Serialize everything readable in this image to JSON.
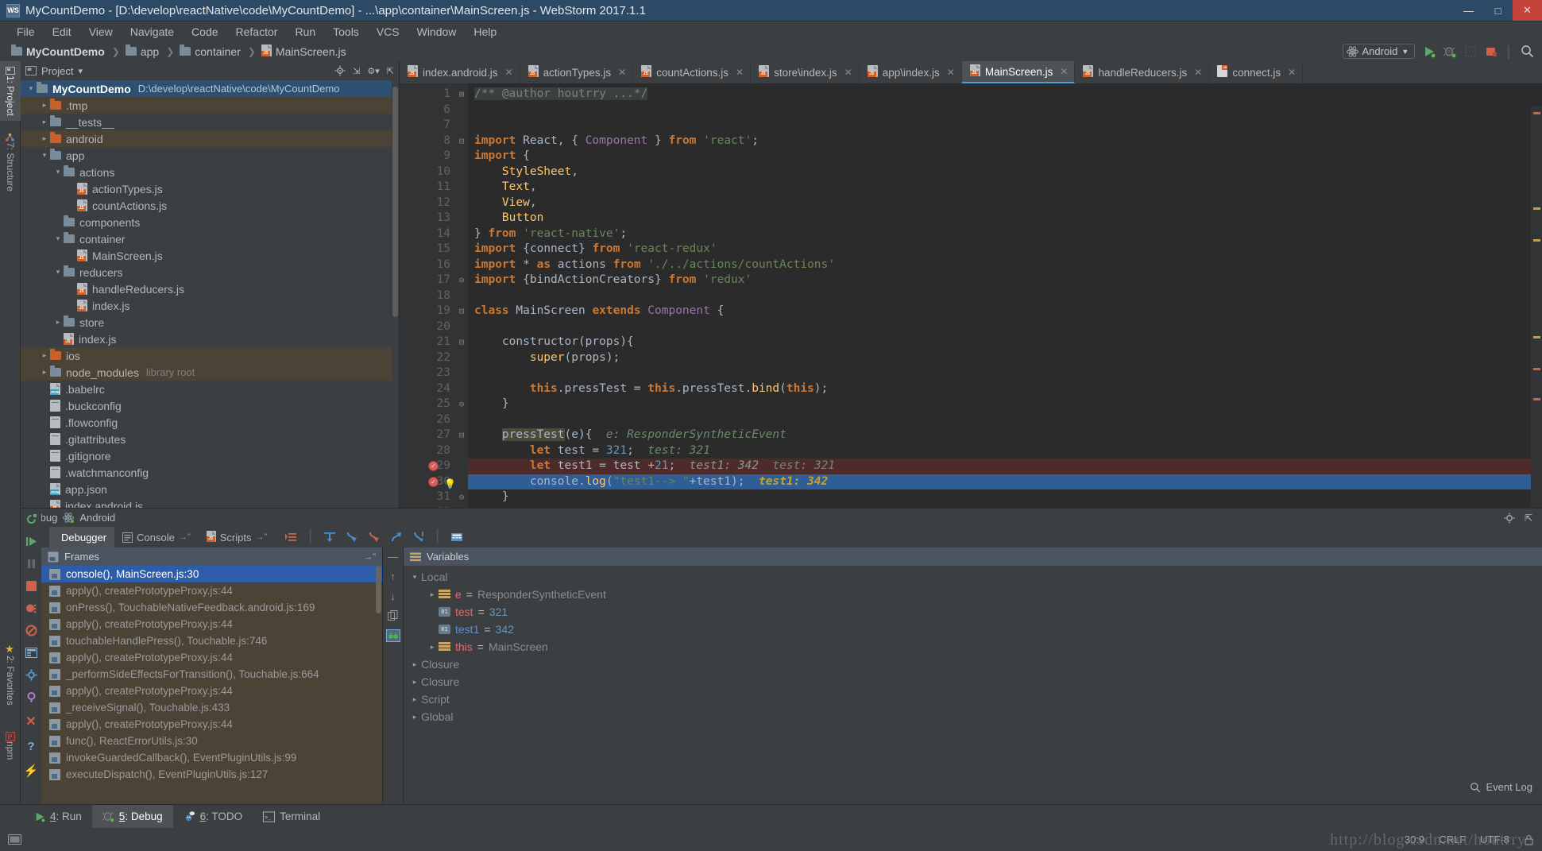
{
  "window": {
    "title": "MyCountDemo - [D:\\develop\\reactNative\\code\\MyCountDemo] - ...\\app\\container\\MainScreen.js - WebStorm 2017.1.1",
    "logo": "WS",
    "minimize": "—",
    "maximize": "□",
    "close": "✕"
  },
  "menubar": [
    {
      "label": "File"
    },
    {
      "label": "Edit"
    },
    {
      "label": "View"
    },
    {
      "label": "Navigate"
    },
    {
      "label": "Code"
    },
    {
      "label": "Refactor"
    },
    {
      "label": "Run"
    },
    {
      "label": "Tools"
    },
    {
      "label": "VCS"
    },
    {
      "label": "Window"
    },
    {
      "label": "Help"
    }
  ],
  "breadcrumb": [
    {
      "label": "MyCountDemo",
      "icon": "folder-icon"
    },
    {
      "label": "app",
      "icon": "folder-icon"
    },
    {
      "label": "container",
      "icon": "folder-icon"
    },
    {
      "label": "MainScreen.js",
      "icon": "js-file-icon"
    }
  ],
  "toolbar": {
    "run_config": "Android",
    "run_button": "run-icon",
    "debug_button": "debug-icon",
    "coverage_button": "coverage-icon",
    "stop_button": "stop-icon",
    "search_button": "search-icon"
  },
  "left_rail": [
    {
      "label": "1: Project",
      "active": true
    },
    {
      "label": "7: Structure",
      "active": false
    },
    {
      "label": "2: Favorites",
      "active": false
    },
    {
      "label": "npm",
      "active": false
    }
  ],
  "project_panel": {
    "title": "Project",
    "chevron": "▾",
    "actions": [
      "gear-icon",
      "collapse-icon",
      "settings-icon",
      "hide-icon"
    ],
    "tree": [
      {
        "depth": 0,
        "arrow": "▾",
        "icon": "folder-icon",
        "label": "MyCountDemo",
        "bold": true,
        "note": "D:\\develop\\reactNative\\code\\MyCountDemo",
        "state": "selected"
      },
      {
        "depth": 1,
        "arrow": "▸",
        "icon": "folder-orange-icon",
        "label": ".tmp",
        "note": "",
        "state": "highlight"
      },
      {
        "depth": 1,
        "arrow": "▸",
        "icon": "folder-icon",
        "label": "__tests__",
        "note": "",
        "state": ""
      },
      {
        "depth": 1,
        "arrow": "▸",
        "icon": "folder-orange-icon",
        "label": "android",
        "note": "",
        "state": "highlight"
      },
      {
        "depth": 1,
        "arrow": "▾",
        "icon": "folder-icon",
        "label": "app",
        "note": "",
        "state": ""
      },
      {
        "depth": 2,
        "arrow": "▾",
        "icon": "folder-icon",
        "label": "actions",
        "note": "",
        "state": ""
      },
      {
        "depth": 3,
        "arrow": "",
        "icon": "js-file-icon",
        "label": "actionTypes.js",
        "note": "",
        "state": ""
      },
      {
        "depth": 3,
        "arrow": "",
        "icon": "js-file-icon",
        "label": "countActions.js",
        "note": "",
        "state": ""
      },
      {
        "depth": 2,
        "arrow": "",
        "icon": "folder-icon",
        "label": "components",
        "note": "",
        "state": ""
      },
      {
        "depth": 2,
        "arrow": "▾",
        "icon": "folder-icon",
        "label": "container",
        "note": "",
        "state": ""
      },
      {
        "depth": 3,
        "arrow": "",
        "icon": "js-file-icon",
        "label": "MainScreen.js",
        "note": "",
        "state": ""
      },
      {
        "depth": 2,
        "arrow": "▾",
        "icon": "folder-icon",
        "label": "reducers",
        "note": "",
        "state": ""
      },
      {
        "depth": 3,
        "arrow": "",
        "icon": "js-file-icon",
        "label": "handleReducers.js",
        "note": "",
        "state": ""
      },
      {
        "depth": 3,
        "arrow": "",
        "icon": "js-file-icon",
        "label": "index.js",
        "note": "",
        "state": ""
      },
      {
        "depth": 2,
        "arrow": "▸",
        "icon": "folder-icon",
        "label": "store",
        "note": "",
        "state": ""
      },
      {
        "depth": 2,
        "arrow": "",
        "icon": "js-file-icon",
        "label": "index.js",
        "note": "",
        "state": ""
      },
      {
        "depth": 1,
        "arrow": "▸",
        "icon": "folder-orange-icon",
        "label": "ios",
        "note": "",
        "state": "highlight"
      },
      {
        "depth": 1,
        "arrow": "▸",
        "icon": "folder-icon",
        "label": "node_modules",
        "note": "library root",
        "state": "highlight"
      },
      {
        "depth": 1,
        "arrow": "",
        "icon": "json-file-icon",
        "label": ".babelrc",
        "note": "",
        "state": ""
      },
      {
        "depth": 1,
        "arrow": "",
        "icon": "text-file-icon",
        "label": ".buckconfig",
        "note": "",
        "state": ""
      },
      {
        "depth": 1,
        "arrow": "",
        "icon": "text-file-icon",
        "label": ".flowconfig",
        "note": "",
        "state": ""
      },
      {
        "depth": 1,
        "arrow": "",
        "icon": "text-file-icon",
        "label": ".gitattributes",
        "note": "",
        "state": ""
      },
      {
        "depth": 1,
        "arrow": "",
        "icon": "text-file-icon",
        "label": ".gitignore",
        "note": "",
        "state": ""
      },
      {
        "depth": 1,
        "arrow": "",
        "icon": "text-file-icon",
        "label": ".watchmanconfig",
        "note": "",
        "state": ""
      },
      {
        "depth": 1,
        "arrow": "",
        "icon": "json-file-icon",
        "label": "app.json",
        "note": "",
        "state": ""
      },
      {
        "depth": 1,
        "arrow": "",
        "icon": "js-file-icon",
        "label": "index.android.js",
        "note": "",
        "state": ""
      }
    ]
  },
  "editor_tabs": [
    {
      "label": "index.android.js",
      "icon": "js-file-icon",
      "active": false
    },
    {
      "label": "actionTypes.js",
      "icon": "js-file-icon",
      "active": false
    },
    {
      "label": "countActions.js",
      "icon": "js-file-icon",
      "active": false
    },
    {
      "label": "store\\index.js",
      "icon": "js-file-icon",
      "active": false
    },
    {
      "label": "app\\index.js",
      "icon": "js-file-icon",
      "active": false
    },
    {
      "label": "MainScreen.js",
      "icon": "js-file-icon",
      "active": true
    },
    {
      "label": "handleReducers.js",
      "icon": "js-file-icon",
      "active": false
    },
    {
      "label": "connect.js",
      "icon": "js-lib-file-icon",
      "active": false
    }
  ],
  "editor": {
    "close_glyph": "✕",
    "lines": [
      {
        "num": "1",
        "fold": "⊞",
        "state": "",
        "breakpoint": false,
        "bulb": false,
        "html": "<span class=\"doc-hl cm\">/** @author houtrry ...*/</span>"
      },
      {
        "num": "6",
        "fold": "",
        "state": "",
        "breakpoint": false,
        "bulb": false,
        "html": ""
      },
      {
        "num": "7",
        "fold": "",
        "state": "",
        "breakpoint": false,
        "bulb": false,
        "html": ""
      },
      {
        "num": "8",
        "fold": "⊟",
        "state": "",
        "breakpoint": false,
        "bulb": false,
        "html": "<span class=\"k\">import</span> <span class=\"pl\">React</span><span class=\"pl\">, { </span><span class=\"typ\">Component</span><span class=\"pl\"> } </span><span class=\"k\">from</span> <span class=\"s\">'react'</span><span class=\"pl\">;</span>"
      },
      {
        "num": "9",
        "fold": "",
        "state": "",
        "breakpoint": false,
        "bulb": false,
        "html": "<span class=\"k\">import</span> <span class=\"pl\">{</span>"
      },
      {
        "num": "10",
        "fold": "",
        "state": "",
        "breakpoint": false,
        "bulb": false,
        "html": "    <span class=\"fn\">StyleSheet</span><span class=\"pl\">,</span>"
      },
      {
        "num": "11",
        "fold": "",
        "state": "",
        "breakpoint": false,
        "bulb": false,
        "html": "    <span class=\"fn\">Text</span><span class=\"pl\">,</span>"
      },
      {
        "num": "12",
        "fold": "",
        "state": "",
        "breakpoint": false,
        "bulb": false,
        "html": "    <span class=\"fn\">View</span><span class=\"pl\">,</span>"
      },
      {
        "num": "13",
        "fold": "",
        "state": "",
        "breakpoint": false,
        "bulb": false,
        "html": "    <span class=\"fn\">Button</span>"
      },
      {
        "num": "14",
        "fold": "",
        "state": "",
        "breakpoint": false,
        "bulb": false,
        "html": "<span class=\"pl\">} </span><span class=\"k\">from</span> <span class=\"s\">'react-native'</span><span class=\"pl\">;</span>"
      },
      {
        "num": "15",
        "fold": "",
        "state": "",
        "breakpoint": false,
        "bulb": false,
        "html": "<span class=\"k\">import</span> <span class=\"pl\">{connect} </span><span class=\"k\">from</span> <span class=\"s\">'react-redux'</span>"
      },
      {
        "num": "16",
        "fold": "",
        "state": "",
        "breakpoint": false,
        "bulb": false,
        "html": "<span class=\"k\">import</span> <span class=\"pl\">* </span><span class=\"k\">as</span> <span class=\"pl\">actions </span><span class=\"k\">from</span> <span class=\"s\">'./../actions/countActions'</span>"
      },
      {
        "num": "17",
        "fold": "⊖",
        "state": "",
        "breakpoint": false,
        "bulb": false,
        "html": "<span class=\"k\">import</span> <span class=\"pl\">{bindActionCreators} </span><span class=\"k\">from</span> <span class=\"s\">'redux'</span>"
      },
      {
        "num": "18",
        "fold": "",
        "state": "",
        "breakpoint": false,
        "bulb": false,
        "html": ""
      },
      {
        "num": "19",
        "fold": "⊟",
        "state": "",
        "breakpoint": false,
        "bulb": false,
        "html": "<span class=\"k\">class</span> <span class=\"pl\">MainScreen</span> <span class=\"k\">extends</span> <span class=\"typ\">Component</span> <span class=\"pl\">{</span>"
      },
      {
        "num": "20",
        "fold": "",
        "state": "",
        "breakpoint": false,
        "bulb": false,
        "html": ""
      },
      {
        "num": "21",
        "fold": "⊟",
        "state": "",
        "breakpoint": false,
        "bulb": false,
        "html": "    <span class=\"pl\">constructor(props){</span>"
      },
      {
        "num": "22",
        "fold": "",
        "state": "",
        "breakpoint": false,
        "bulb": false,
        "html": "        <span class=\"fn\">super</span><span class=\"pl\">(props);</span>"
      },
      {
        "num": "23",
        "fold": "",
        "state": "",
        "breakpoint": false,
        "bulb": false,
        "html": ""
      },
      {
        "num": "24",
        "fold": "",
        "state": "",
        "breakpoint": false,
        "bulb": false,
        "html": "        <span class=\"k\">this</span><span class=\"pl\">.pressTest = </span><span class=\"k\">this</span><span class=\"pl\">.pressTest.</span><span class=\"fn\">bind</span><span class=\"pl\">(</span><span class=\"k\">this</span><span class=\"pl\">);</span>"
      },
      {
        "num": "25",
        "fold": "⊖",
        "state": "",
        "breakpoint": false,
        "bulb": false,
        "html": "    <span class=\"pl\">}</span>"
      },
      {
        "num": "26",
        "fold": "",
        "state": "",
        "breakpoint": false,
        "bulb": false,
        "html": ""
      },
      {
        "num": "27",
        "fold": "⊟",
        "state": "",
        "breakpoint": false,
        "bulb": false,
        "html": "    <span class=\"hl-ident\">pressTest</span><span class=\"pl\">(e){</span>  <span class=\"hint\">e: ResponderSyntheticEvent</span>"
      },
      {
        "num": "28",
        "fold": "",
        "state": "",
        "breakpoint": false,
        "bulb": false,
        "html": "        <span class=\"k\">let</span> <span class=\"pl\">test = </span><span class=\"num\">321</span><span class=\"pl\">;</span>  <span class=\"hint\">test: 321</span>"
      },
      {
        "num": "29",
        "fold": "",
        "state": "err-line",
        "breakpoint": true,
        "bulb": false,
        "html": "        <span class=\"k\">let</span> <span class=\"pl\">test1 = test +</span><span class=\"num\">21</span><span class=\"pl\">;</span>  <span class=\"hint2\">test1: 342</span>  <span class=\"hint\">test: 321</span>"
      },
      {
        "num": "30",
        "fold": "",
        "state": "exec-line",
        "breakpoint": true,
        "bulb": true,
        "html": "        <span class=\"pl\">console.</span><span class=\"fn\">log</span><span class=\"pl\">(</span><span class=\"s\">\"test1--> \"</span><span class=\"pl\">+test1);</span>  <span class=\"hinty\">test1: 342</span>"
      },
      {
        "num": "31",
        "fold": "⊖",
        "state": "",
        "breakpoint": false,
        "bulb": false,
        "html": "    <span class=\"pl\">}</span>"
      },
      {
        "num": "32",
        "fold": "",
        "state": "",
        "breakpoint": false,
        "bulb": false,
        "html": ""
      }
    ]
  },
  "debug": {
    "title": "Debug",
    "config_name": "Android",
    "config_icon": "react-icon",
    "tabs": [
      {
        "label": "Debugger",
        "icon": "debugger-icon",
        "active": true
      },
      {
        "label": "Console",
        "icon": "console-icon",
        "active": false,
        "pin": "→\""
      },
      {
        "label": "Scripts",
        "icon": "js-file-icon",
        "active": false,
        "pin": "→\""
      }
    ],
    "toolbar_icons": [
      "mute-breakpoints-icon",
      "step-over-icon",
      "step-into-icon",
      "force-step-into-icon",
      "step-out-icon",
      "run-to-cursor-icon",
      "evaluate-expression-icon"
    ],
    "frames": {
      "header": "Frames",
      "header_icon": "frames-icon",
      "pin": "→\"",
      "items": [
        {
          "label": "console(), MainScreen.js:30",
          "selected": true
        },
        {
          "label": "apply(), createPrototypeProxy.js:44",
          "selected": false
        },
        {
          "label": "onPress(), TouchableNativeFeedback.android.js:169",
          "selected": false
        },
        {
          "label": "apply(), createPrototypeProxy.js:44",
          "selected": false
        },
        {
          "label": "touchableHandlePress(), Touchable.js:746",
          "selected": false
        },
        {
          "label": "apply(), createPrototypeProxy.js:44",
          "selected": false
        },
        {
          "label": "_performSideEffectsForTransition(), Touchable.js:664",
          "selected": false
        },
        {
          "label": "apply(), createPrototypeProxy.js:44",
          "selected": false
        },
        {
          "label": "_receiveSignal(), Touchable.js:433",
          "selected": false
        },
        {
          "label": "apply(), createPrototypeProxy.js:44",
          "selected": false
        },
        {
          "label": "func(), ReactErrorUtils.js:30",
          "selected": false
        },
        {
          "label": "invokeGuardedCallback(), EventPluginUtils.js:99",
          "selected": false
        },
        {
          "label": "executeDispatch(), EventPluginUtils.js:127",
          "selected": false
        }
      ]
    },
    "variables": {
      "header": "Variables",
      "header_icon": "variables-icon",
      "rows": [
        {
          "depth": 0,
          "arrow": "▾",
          "icon": "",
          "name": "Local",
          "name_class": "vval-dim",
          "eq": "",
          "value": "",
          "value_class": ""
        },
        {
          "depth": 1,
          "arrow": "▸",
          "icon": "obj",
          "name": "e",
          "name_class": "vname-red",
          "eq": "=",
          "value": "ResponderSyntheticEvent",
          "value_class": "vval-dim"
        },
        {
          "depth": 1,
          "arrow": "",
          "icon": "prim",
          "name": "test",
          "name_class": "vname-red",
          "eq": "=",
          "value": "321",
          "value_class": "vval-num"
        },
        {
          "depth": 1,
          "arrow": "",
          "icon": "prim",
          "name": "test1",
          "name_class": "vname-blue",
          "eq": "=",
          "value": "342",
          "value_class": "vval-num"
        },
        {
          "depth": 1,
          "arrow": "▸",
          "icon": "obj",
          "name": "this",
          "name_class": "vname-red",
          "eq": "=",
          "value": "MainScreen",
          "value_class": "vval-dim"
        },
        {
          "depth": 0,
          "arrow": "▸",
          "icon": "",
          "name": "Closure",
          "name_class": "vval-dim",
          "eq": "",
          "value": "",
          "value_class": ""
        },
        {
          "depth": 0,
          "arrow": "▸",
          "icon": "",
          "name": "Closure",
          "name_class": "vval-dim",
          "eq": "",
          "value": "",
          "value_class": ""
        },
        {
          "depth": 0,
          "arrow": "▸",
          "icon": "",
          "name": "Script",
          "name_class": "vval-dim",
          "eq": "",
          "value": "",
          "value_class": ""
        },
        {
          "depth": 0,
          "arrow": "▸",
          "icon": "",
          "name": "Global",
          "name_class": "vval-dim",
          "eq": "",
          "value": "",
          "value_class": ""
        }
      ]
    }
  },
  "bottom_tabs": [
    {
      "num": "4",
      "label": ": Run",
      "icon": "run-icon",
      "active": false
    },
    {
      "num": "5",
      "label": ": Debug",
      "icon": "debug-icon",
      "active": true
    },
    {
      "num": "6",
      "label": ": TODO",
      "icon": "todo-icon",
      "active": false
    },
    {
      "num": "",
      "label": "Terminal",
      "icon": "terminal-icon",
      "active": false
    }
  ],
  "statusbar": {
    "event_log": "Event Log",
    "event_log_icon": "search-icon",
    "caret": "30:9",
    "line_separator": "CRLF",
    "encoding": "UTF-8",
    "lock_icon": "lock-icon",
    "watermark": "http://blog.csdn.net/houtrry"
  }
}
